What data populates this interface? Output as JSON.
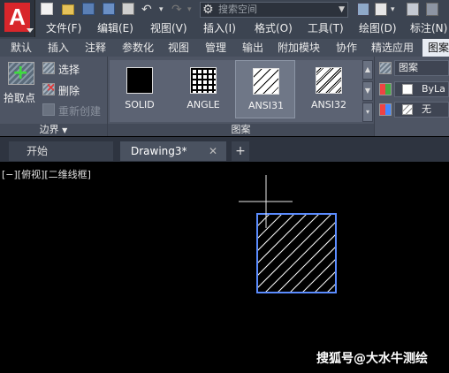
{
  "workspace": {
    "placeholder": "搜索空间"
  },
  "menu": [
    "文件(F)",
    "编辑(E)",
    "视图(V)",
    "插入(I)",
    "格式(O)",
    "工具(T)",
    "绘图(D)",
    "标注(N)"
  ],
  "ribbon_tabs": [
    "默认",
    "插入",
    "注释",
    "参数化",
    "视图",
    "管理",
    "输出",
    "附加模块",
    "协作",
    "精选应用",
    "图案"
  ],
  "boundary_panel": {
    "pick_points": "拾取点",
    "select": "选择",
    "remove": "删除",
    "recreate": "重新创建",
    "title": "边界"
  },
  "pattern_panel": {
    "title": "图案",
    "patterns": [
      "SOLID",
      "ANGLE",
      "ANSI31",
      "ANSI32"
    ],
    "selected": "ANSI31"
  },
  "properties_panel": {
    "pattern_type": "图案",
    "color": "ByLa",
    "background": "无"
  },
  "file_tabs": {
    "home": "开始",
    "drawing": "Drawing3*",
    "add": "+"
  },
  "canvas": {
    "view_label": "[−][俯视][二维线框]",
    "watermark": "搜狐号@大水牛测绘"
  },
  "colors": {
    "accent_red": "#d8262b",
    "selection_blue": "#5b8cff",
    "hatch": "#ffffff"
  }
}
